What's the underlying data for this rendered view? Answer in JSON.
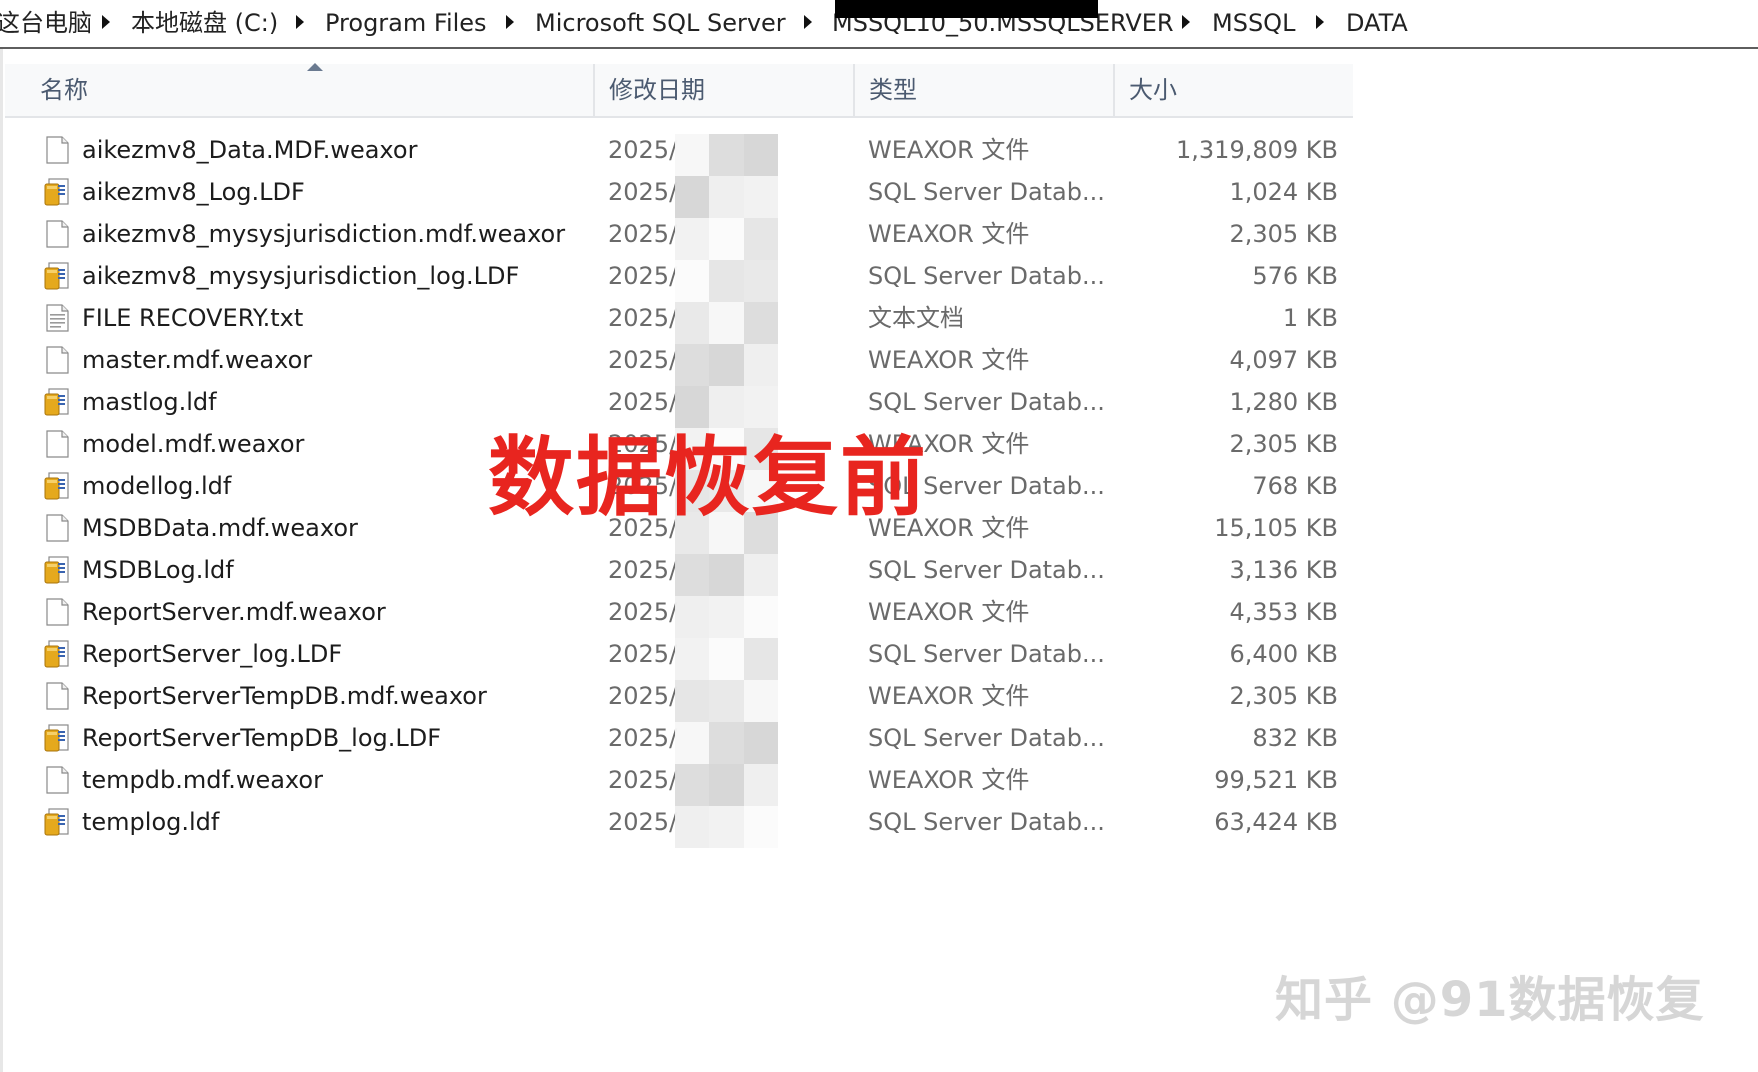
{
  "breadcrumb": {
    "items": [
      {
        "label": "这台电脑"
      },
      {
        "label": "本地磁盘 (C:)"
      },
      {
        "label": "Program Files"
      },
      {
        "label": "Microsoft SQL Server"
      },
      {
        "label": "MSSQL10_50.MSSQLSERVER"
      },
      {
        "label": "MSSQL"
      },
      {
        "label": "DATA"
      }
    ]
  },
  "columns": {
    "name": "名称",
    "date": "修改日期",
    "type": "类型",
    "size": "大小"
  },
  "files": [
    {
      "name": "aikezmv8_Data.MDF.weaxor",
      "date": "2025/",
      "type": "WEAXOR 文件",
      "size": "1,319,809 KB",
      "icon": "blank-file-icon"
    },
    {
      "name": "aikezmv8_Log.LDF",
      "date": "2025/",
      "type": "SQL Server Datab...",
      "size": "1,024 KB",
      "icon": "sql-database-file-icon"
    },
    {
      "name": "aikezmv8_mysysjurisdiction.mdf.weaxor",
      "date": "2025/",
      "type": "WEAXOR 文件",
      "size": "2,305 KB",
      "icon": "blank-file-icon"
    },
    {
      "name": "aikezmv8_mysysjurisdiction_log.LDF",
      "date": "2025/",
      "type": "SQL Server Datab...",
      "size": "576 KB",
      "icon": "sql-database-file-icon"
    },
    {
      "name": "FILE RECOVERY.txt",
      "date": "2025/",
      "type": "文本文档",
      "size": "1 KB",
      "icon": "text-document-icon"
    },
    {
      "name": "master.mdf.weaxor",
      "date": "2025/",
      "type": "WEAXOR 文件",
      "size": "4,097 KB",
      "icon": "blank-file-icon"
    },
    {
      "name": "mastlog.ldf",
      "date": "2025/",
      "type": "SQL Server Datab...",
      "size": "1,280 KB",
      "icon": "sql-database-file-icon"
    },
    {
      "name": "model.mdf.weaxor",
      "date": "2025/",
      "type": "WEAXOR 文件",
      "size": "2,305 KB",
      "icon": "blank-file-icon"
    },
    {
      "name": "modellog.ldf",
      "date": "2025/",
      "type": "SQL Server Datab...",
      "size": "768 KB",
      "icon": "sql-database-file-icon"
    },
    {
      "name": "MSDBData.mdf.weaxor",
      "date": "2025/",
      "type": "WEAXOR 文件",
      "size": "15,105 KB",
      "icon": "blank-file-icon"
    },
    {
      "name": "MSDBLog.ldf",
      "date": "2025/",
      "type": "SQL Server Datab...",
      "size": "3,136 KB",
      "icon": "sql-database-file-icon"
    },
    {
      "name": "ReportServer.mdf.weaxor",
      "date": "2025/",
      "type": "WEAXOR 文件",
      "size": "4,353 KB",
      "icon": "blank-file-icon"
    },
    {
      "name": "ReportServer_log.LDF",
      "date": "2025/",
      "type": "SQL Server Datab...",
      "size": "6,400 KB",
      "icon": "sql-database-file-icon"
    },
    {
      "name": "ReportServerTempDB.mdf.weaxor",
      "date": "2025/",
      "type": "WEAXOR 文件",
      "size": "2,305 KB",
      "icon": "blank-file-icon"
    },
    {
      "name": "ReportServerTempDB_log.LDF",
      "date": "2025/",
      "type": "SQL Server Datab...",
      "size": "832 KB",
      "icon": "sql-database-file-icon"
    },
    {
      "name": "tempdb.mdf.weaxor",
      "date": "2025/",
      "type": "WEAXOR 文件",
      "size": "99,521 KB",
      "icon": "blank-file-icon"
    },
    {
      "name": "templog.ldf",
      "date": "2025/",
      "type": "SQL Server Datab...",
      "size": "63,424 KB",
      "icon": "sql-database-file-icon"
    }
  ],
  "overlay": {
    "caption": "数据恢复前",
    "caption_color": "#e8251f"
  },
  "watermark": {
    "text": "知乎 @91数据恢复"
  }
}
